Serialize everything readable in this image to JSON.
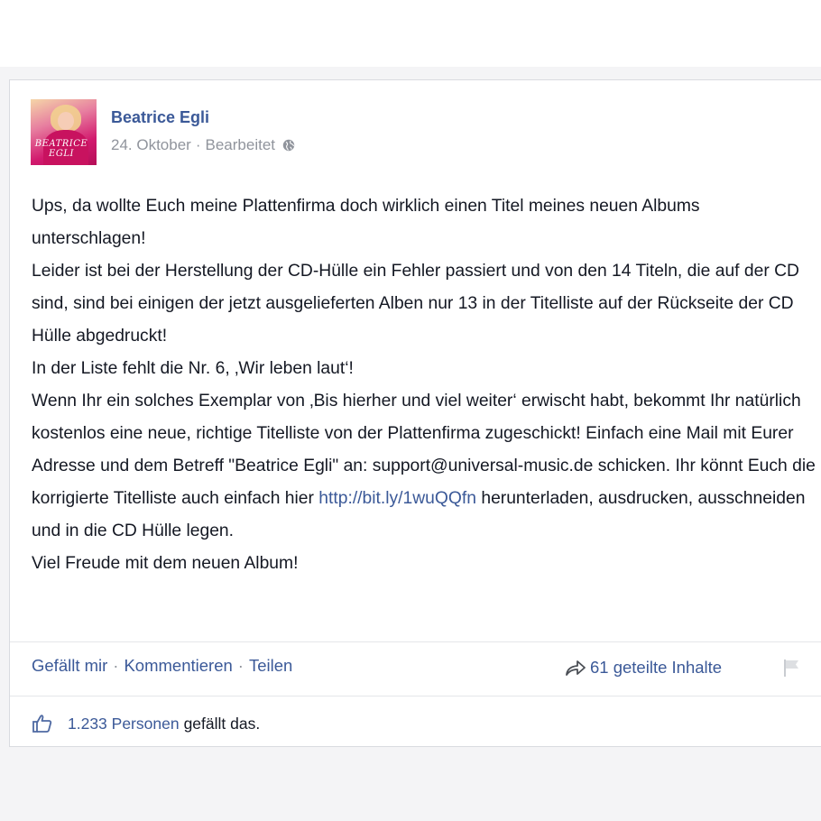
{
  "post": {
    "author": "Beatrice Egli",
    "date": "24. Oktober",
    "meta_separator": "·",
    "edited": "Bearbeitet",
    "avatar_text": [
      "BEATRICE",
      "EGLI"
    ],
    "paragraphs": [
      "Ups, da wollte Euch meine Plattenfirma doch wirklich einen Titel meines neuen Albums unterschlagen!",
      "Leider ist bei der Herstellung der CD-Hülle ein Fehler passiert und von den 14 Titeln, die auf der CD sind, sind bei einigen der jetzt ausgelieferten Alben nur 13 in der Titelliste auf der Rückseite der CD Hülle abgedruckt!",
      "In der Liste fehlt die Nr. 6, ‚Wir leben laut‘!"
    ],
    "para4_before_link": "Wenn Ihr ein solches Exemplar von ‚Bis hierher und viel weiter‘ erwischt habt, bekommt Ihr natürlich kostenlos eine neue, richtige Titelliste von der Plattenfirma zugeschickt! Einfach eine Mail mit Eurer Adresse und dem Betreff \"Beatrice Egli\" an: support@universal-music.de schicken. Ihr könnt Euch die korrigierte Titelliste auch einfach hier ",
    "link": "http://bit.ly/1wuQQfn",
    "para4_after_link": " herunterladen, ausdrucken, ausschneiden und in die CD Hülle legen.",
    "closing": "Viel Freude mit dem neuen Album!"
  },
  "actions": {
    "like": "Gefällt mir",
    "comment": "Kommentieren",
    "share": "Teilen",
    "separator": "·",
    "shares_count": "61 geteilte Inhalte"
  },
  "likes": {
    "count": "1.233 Personen",
    "suffix": "gefällt das."
  },
  "colors": {
    "link": "#3b5998",
    "text": "#141823",
    "meta": "#90949c"
  },
  "icons": [
    "globe-icon",
    "share-arrow-icon",
    "flag-icon",
    "thumbs-up-icon"
  ]
}
